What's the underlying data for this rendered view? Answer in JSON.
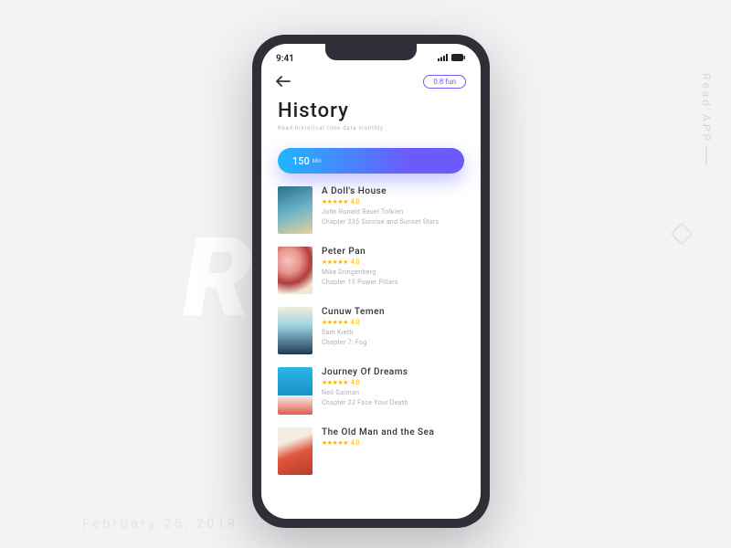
{
  "background": {
    "big_word": "READ",
    "side_label": "Read APP",
    "date": "February 25, 2019"
  },
  "statusbar": {
    "time": "9:41"
  },
  "header": {
    "pill_label": "0.8 fun"
  },
  "page": {
    "title": "History",
    "subtitle": "Read historical time data monthly",
    "bar_value": "150",
    "bar_unit": "Min"
  },
  "books": [
    {
      "title": "A Doll's House",
      "rating": "4.0",
      "author": "John Ronald Reuel Tolkien",
      "chapter": "Chapter 235 Sunrise and Sunset Stars"
    },
    {
      "title": "Peter Pan",
      "rating": "4.0",
      "author": "Mike Dringenberg",
      "chapter": "Chapter 15 Power Pillars"
    },
    {
      "title": "Cunuw Temen",
      "rating": "4.0",
      "author": "Sam Kieth",
      "chapter": "Chapter 7: Fog"
    },
    {
      "title": "Journey Of Dreams",
      "rating": "4.0",
      "author": "Neil Gaiman",
      "chapter": "Chapter 23 Face Your Death"
    },
    {
      "title": "The Old Man and the Sea",
      "rating": "4.0",
      "author": "",
      "chapter": ""
    }
  ]
}
